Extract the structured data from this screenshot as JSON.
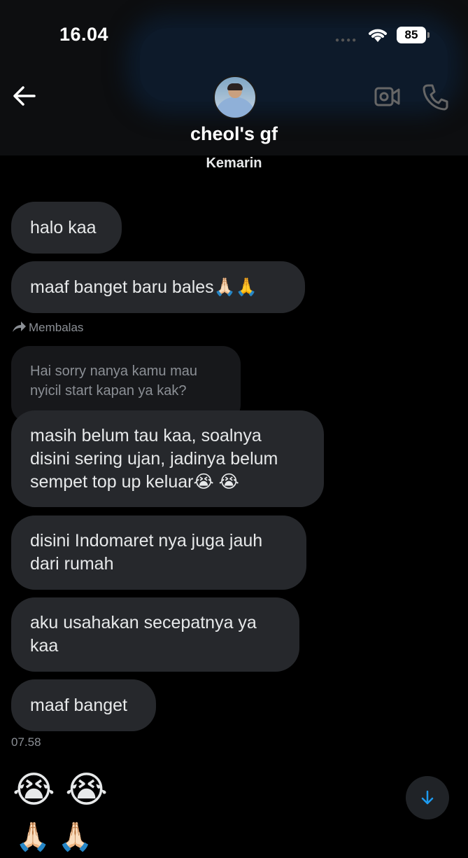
{
  "status_bar": {
    "time": "16.04",
    "battery": "85"
  },
  "header": {
    "contact_name": "cheol's gf",
    "subtitle": "Kemarin"
  },
  "conversation": {
    "reply_label": "Membalas",
    "quoted_message": "Hai sorry nanya kamu mau nyicil start kapan ya kak?",
    "messages": [
      "halo kaa",
      "maaf banget baru bales🙏🏻🙏",
      "masih belum tau kaa, soalnya disini sering ujan, jadinya belum sempet top up keluar😭 😭",
      "disini Indomaret nya juga jauh dari rumah",
      "aku usahakan secepatnya ya kaa",
      "maaf banget"
    ],
    "timestamp": "07.58",
    "emoji_row_1": "😭 😭",
    "emoji_row_2": "🙏🏻 🙏🏻"
  },
  "colors": {
    "background": "#000000",
    "bubble": "#26282c",
    "accent": "#1d9bf0"
  }
}
